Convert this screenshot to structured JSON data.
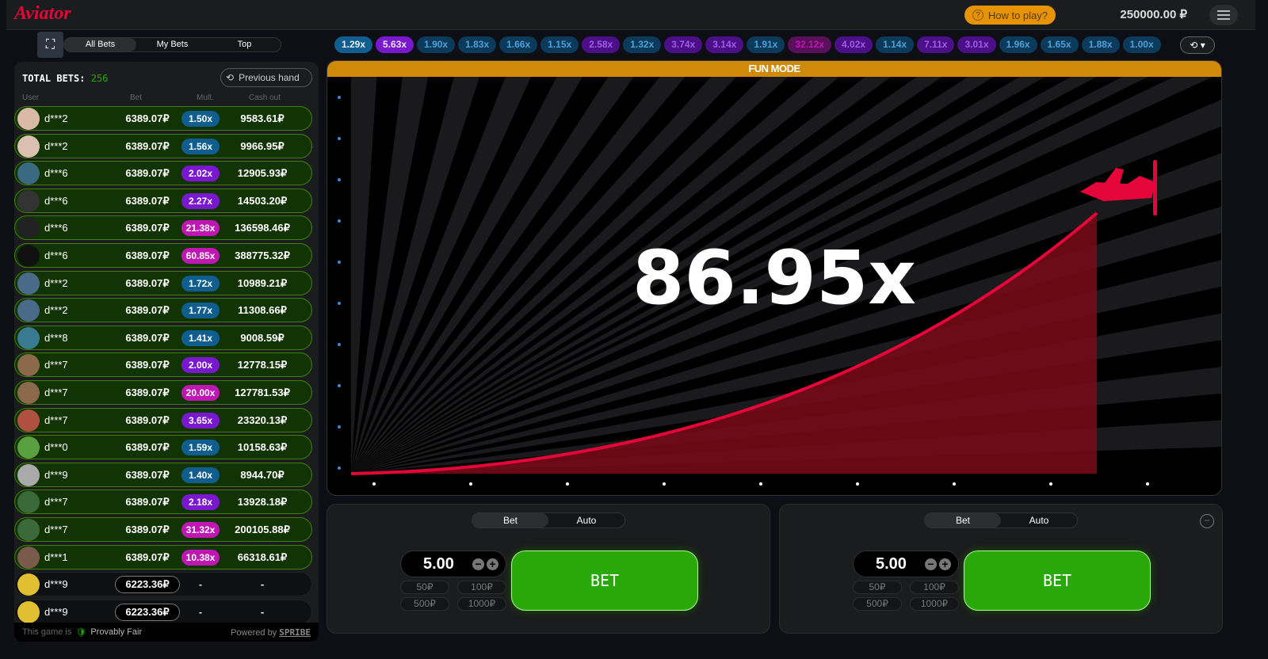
{
  "header": {
    "logo": "Aviator",
    "how_to_play": "How to play?",
    "balance": "250000.00 ₽"
  },
  "bets_tabs": [
    "All Bets",
    "My Bets",
    "Top"
  ],
  "history": [
    "1.29x",
    "5.63x",
    "1.90x",
    "1.83x",
    "1.66x",
    "1.15x",
    "2.58x",
    "1.32x",
    "3.74x",
    "3.14x",
    "1.91x",
    "32.12x",
    "4.02x",
    "1.14x",
    "7.11x",
    "3.01x",
    "1.96x",
    "1.65x",
    "1.88x",
    "1.00x"
  ],
  "bets": {
    "total_label": "TOTAL BETS:",
    "total": "256",
    "previous_hand": "Previous hand",
    "columns": [
      "User",
      "Bet",
      "Mult.",
      "Cash out"
    ],
    "rows": [
      {
        "user": "d***2",
        "bet": "6389.07₽",
        "mult": "1.50x",
        "cashout": "9583.61₽"
      },
      {
        "user": "d***2",
        "bet": "6389.07₽",
        "mult": "1.56x",
        "cashout": "9966.95₽"
      },
      {
        "user": "d***6",
        "bet": "6389.07₽",
        "mult": "2.02x",
        "cashout": "12905.93₽"
      },
      {
        "user": "d***6",
        "bet": "6389.07₽",
        "mult": "2.27x",
        "cashout": "14503.20₽"
      },
      {
        "user": "d***6",
        "bet": "6389.07₽",
        "mult": "21.38x",
        "cashout": "136598.46₽"
      },
      {
        "user": "d***6",
        "bet": "6389.07₽",
        "mult": "60.85x",
        "cashout": "388775.32₽"
      },
      {
        "user": "d***2",
        "bet": "6389.07₽",
        "mult": "1.72x",
        "cashout": "10989.21₽"
      },
      {
        "user": "d***2",
        "bet": "6389.07₽",
        "mult": "1.77x",
        "cashout": "11308.66₽"
      },
      {
        "user": "d***8",
        "bet": "6389.07₽",
        "mult": "1.41x",
        "cashout": "9008.59₽"
      },
      {
        "user": "d***7",
        "bet": "6389.07₽",
        "mult": "2.00x",
        "cashout": "12778.15₽"
      },
      {
        "user": "d***7",
        "bet": "6389.07₽",
        "mult": "20.00x",
        "cashout": "127781.53₽"
      },
      {
        "user": "d***7",
        "bet": "6389.07₽",
        "mult": "3.65x",
        "cashout": "23320.13₽"
      },
      {
        "user": "d***0",
        "bet": "6389.07₽",
        "mult": "1.59x",
        "cashout": "10158.63₽"
      },
      {
        "user": "d***9",
        "bet": "6389.07₽",
        "mult": "1.40x",
        "cashout": "8944.70₽"
      },
      {
        "user": "d***7",
        "bet": "6389.07₽",
        "mult": "2.18x",
        "cashout": "13928.18₽"
      },
      {
        "user": "d***7",
        "bet": "6389.07₽",
        "mult": "31.32x",
        "cashout": "200105.88₽"
      },
      {
        "user": "d***1",
        "bet": "6389.07₽",
        "mult": "10.38x",
        "cashout": "66318.61₽"
      },
      {
        "user": "d***9",
        "bet": "6223.36₽",
        "mult": "-",
        "cashout": "-"
      },
      {
        "user": "d***9",
        "bet": "6223.36₽",
        "mult": "-",
        "cashout": "-"
      }
    ],
    "footer_prefix": "This game is",
    "provably_fair": "Provably Fair",
    "powered_by": "Powered by",
    "brand": "SPRIBE"
  },
  "game": {
    "mode": "FUN MODE",
    "multiplier": "86.95x"
  },
  "bet_panels": [
    {
      "tabs": [
        "Bet",
        "Auto"
      ],
      "amount": "5.00",
      "quick": [
        "50₽",
        "100₽",
        "500₽",
        "1000₽"
      ],
      "button": "BET"
    },
    {
      "tabs": [
        "Bet",
        "Auto"
      ],
      "amount": "5.00",
      "quick": [
        "50₽",
        "100₽",
        "500₽",
        "1000₽"
      ],
      "button": "BET"
    }
  ],
  "colors": {
    "accent": "#e50539",
    "win": "#28a909",
    "fun_mode": "#d08a0a",
    "mult_low": "#0f5e8f",
    "mult_mid": "#7a18d0",
    "mult_high": "#c017b4"
  }
}
